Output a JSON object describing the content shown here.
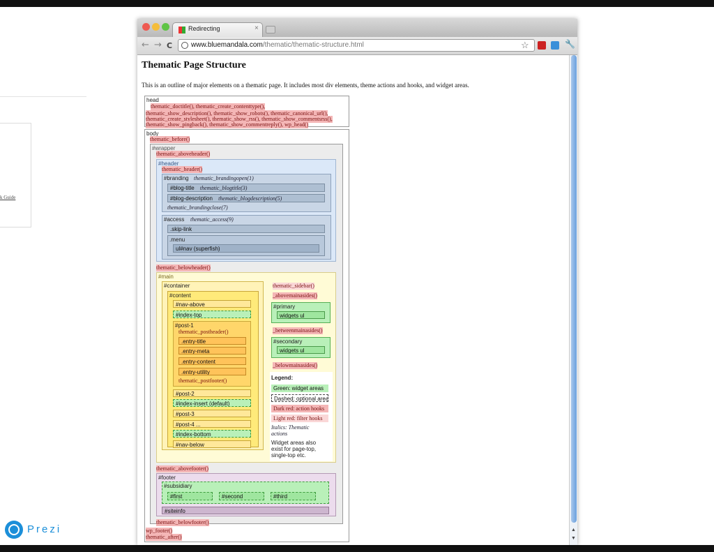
{
  "left_panel": {
    "link_text": "k Guide"
  },
  "prezi": {
    "brand": "Prezi"
  },
  "browser": {
    "tab_title": "Redirecting",
    "url_host": "www.bluemandala.com",
    "url_path": "/thematic/thematic-structure.html",
    "back_icon": "←",
    "forward_icon": "→",
    "reload_icon": "C",
    "star_icon": "☆",
    "wrench_icon": "🔧",
    "close_icon": "×"
  },
  "page": {
    "title": "Thematic Page Structure",
    "intro": "This is an outline of major elements on a thematic page. It includes most div elements, theme actions and hooks, and widget areas."
  },
  "head": {
    "label": "head",
    "lines": [
      "thematic_doctitle(), thematic_create_contenttype(),",
      "thematic_show_description(), thematic_show_robots(), thematic_canonical_url(),",
      "thematic_create_stylesheet(), thematic_show_rss(), thematic_show_commentsrss(),",
      "thematic_show_pingback(), thematic_show_commentreply(), wp_head()"
    ]
  },
  "body": {
    "label": "body",
    "before": "thematic_before()",
    "wrapper": "#wrapper",
    "aboveheader": "thematic_aboveheader()",
    "header": "#header",
    "header_hook": "thematic_header()",
    "branding": "#branding",
    "brandingopen": "thematic_brandingopen(1)",
    "blog_title": "#blog-title",
    "blogtitle_hook": "thematic_blogtitle(3)",
    "blog_description": "#blog-description",
    "blogdescription_hook": "thematic_blogdescription(5)",
    "brandingclose": "thematic_brandingclose(7)",
    "access": "#access",
    "access_hook": "thematic_access(9)",
    "skip_link": ".skip-link",
    "menu": ".menu",
    "nav": "ul#nav (superfish)",
    "belowheader": "thematic_belowheader()",
    "main": "#main",
    "container": "#container",
    "content": "#content",
    "nav_above": "#nav-above",
    "index_top": "#index-top",
    "post1": "#post-1",
    "postheader": "thematic_postheader()",
    "entry_title": ".entry-title",
    "entry_meta": ".entry-meta",
    "entry_content": ".entry-content",
    "entry_utility": ".entry-utility",
    "postfooter": "thematic_postfooter()",
    "post2": "#post-2",
    "index_insert": "#index-insert (default)",
    "post3": "#post-3",
    "post4": "#post-4 ...",
    "index_bottom": "#index-bottom",
    "nav_below": "#nav-below",
    "sidebar_hook": "thematic_sidebar()",
    "abovemainasides": "_abovemainasides()",
    "primary": "#primary",
    "widgets_ul": "widgets ul",
    "betweenmainasides": "_betweenmainasides()",
    "secondary": "#secondary",
    "belowmainasides": "_belowmainasides()",
    "abovefooter": "thematic_abovefooter()",
    "footer": "#footer",
    "subsidiary": "#subsidiary",
    "first": "#first",
    "second": "#second",
    "third": "#third",
    "siteinfo": "#siteinfo",
    "belowfooter": "thematic_belowfooter()",
    "wp_footer": "wp_footer()",
    "after": "thematic_after()"
  },
  "legend": {
    "title": "Legend:",
    "green": "Green: widget areas",
    "dashed": "Dashed: optional area",
    "darkred": "Dark red: action hooks",
    "lightred": "Light red: filter hooks",
    "italics_1": "Italics: Thematic",
    "italics_2": "actions",
    "note_1": "Widget areas also",
    "note_2": "exist for page-top,",
    "note_3": "single-top etc."
  },
  "colors": {
    "header_bg": "#dbe8f8",
    "main_bg": "#fffbd6",
    "container_bg": "#fff3b8",
    "content_bg": "#ffea7a",
    "footer_bg": "#ecdced",
    "widget_green": "#b9f0b9"
  }
}
